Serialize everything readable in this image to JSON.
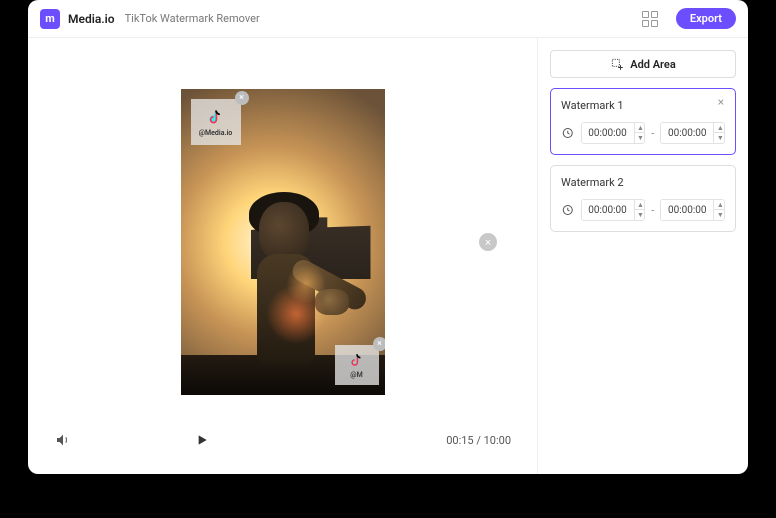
{
  "header": {
    "brand": "Media.io",
    "title": "TikTok Watermark Remover",
    "export_label": "Export"
  },
  "preview": {
    "watermark1_handle": "@Media.io",
    "watermark2_handle": "@M",
    "time_display": "00:15 / 10:00"
  },
  "sidebar": {
    "add_area_label": "Add Area",
    "areas": [
      {
        "title": "Watermark 1",
        "start": "00:00:00",
        "end": "00:00:00",
        "active": true
      },
      {
        "title": "Watermark 2",
        "start": "00:00:00",
        "end": "00:00:00",
        "active": false
      }
    ]
  }
}
